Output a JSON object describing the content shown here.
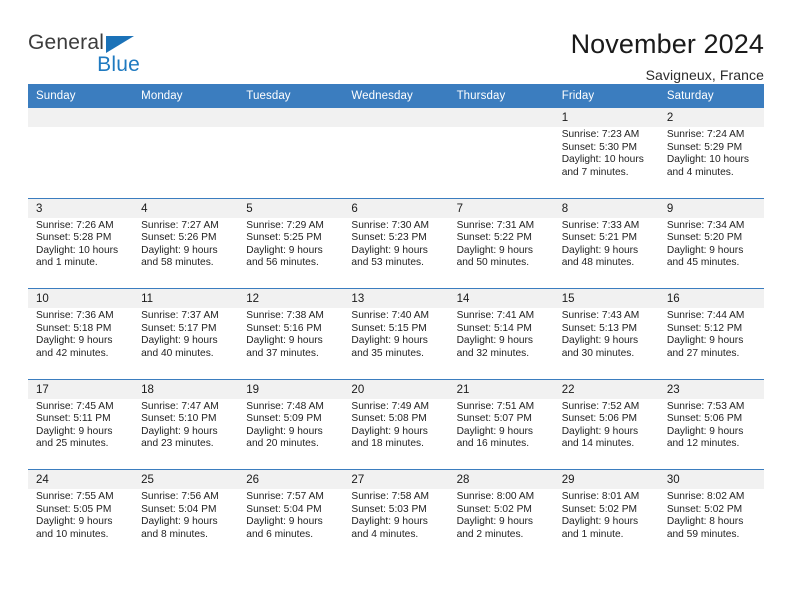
{
  "brand": {
    "name_top": "General",
    "name_bottom": "Blue",
    "color_top": "#3c3c3c",
    "color_blue": "#1b72b8"
  },
  "header": {
    "title": "November 2024",
    "location": "Savigneux, France"
  },
  "calendar": {
    "accent_color": "#3b7dbf",
    "daynum_bg": "#f1f1f1",
    "weekday_headers": [
      "Sunday",
      "Monday",
      "Tuesday",
      "Wednesday",
      "Thursday",
      "Friday",
      "Saturday"
    ],
    "weeks": [
      [
        {
          "day": "",
          "sunrise": "",
          "sunset": "",
          "daylight1": "",
          "daylight2": ""
        },
        {
          "day": "",
          "sunrise": "",
          "sunset": "",
          "daylight1": "",
          "daylight2": ""
        },
        {
          "day": "",
          "sunrise": "",
          "sunset": "",
          "daylight1": "",
          "daylight2": ""
        },
        {
          "day": "",
          "sunrise": "",
          "sunset": "",
          "daylight1": "",
          "daylight2": ""
        },
        {
          "day": "",
          "sunrise": "",
          "sunset": "",
          "daylight1": "",
          "daylight2": ""
        },
        {
          "day": "1",
          "sunrise": "Sunrise: 7:23 AM",
          "sunset": "Sunset: 5:30 PM",
          "daylight1": "Daylight: 10 hours",
          "daylight2": "and 7 minutes."
        },
        {
          "day": "2",
          "sunrise": "Sunrise: 7:24 AM",
          "sunset": "Sunset: 5:29 PM",
          "daylight1": "Daylight: 10 hours",
          "daylight2": "and 4 minutes."
        }
      ],
      [
        {
          "day": "3",
          "sunrise": "Sunrise: 7:26 AM",
          "sunset": "Sunset: 5:28 PM",
          "daylight1": "Daylight: 10 hours",
          "daylight2": "and 1 minute."
        },
        {
          "day": "4",
          "sunrise": "Sunrise: 7:27 AM",
          "sunset": "Sunset: 5:26 PM",
          "daylight1": "Daylight: 9 hours",
          "daylight2": "and 58 minutes."
        },
        {
          "day": "5",
          "sunrise": "Sunrise: 7:29 AM",
          "sunset": "Sunset: 5:25 PM",
          "daylight1": "Daylight: 9 hours",
          "daylight2": "and 56 minutes."
        },
        {
          "day": "6",
          "sunrise": "Sunrise: 7:30 AM",
          "sunset": "Sunset: 5:23 PM",
          "daylight1": "Daylight: 9 hours",
          "daylight2": "and 53 minutes."
        },
        {
          "day": "7",
          "sunrise": "Sunrise: 7:31 AM",
          "sunset": "Sunset: 5:22 PM",
          "daylight1": "Daylight: 9 hours",
          "daylight2": "and 50 minutes."
        },
        {
          "day": "8",
          "sunrise": "Sunrise: 7:33 AM",
          "sunset": "Sunset: 5:21 PM",
          "daylight1": "Daylight: 9 hours",
          "daylight2": "and 48 minutes."
        },
        {
          "day": "9",
          "sunrise": "Sunrise: 7:34 AM",
          "sunset": "Sunset: 5:20 PM",
          "daylight1": "Daylight: 9 hours",
          "daylight2": "and 45 minutes."
        }
      ],
      [
        {
          "day": "10",
          "sunrise": "Sunrise: 7:36 AM",
          "sunset": "Sunset: 5:18 PM",
          "daylight1": "Daylight: 9 hours",
          "daylight2": "and 42 minutes."
        },
        {
          "day": "11",
          "sunrise": "Sunrise: 7:37 AM",
          "sunset": "Sunset: 5:17 PM",
          "daylight1": "Daylight: 9 hours",
          "daylight2": "and 40 minutes."
        },
        {
          "day": "12",
          "sunrise": "Sunrise: 7:38 AM",
          "sunset": "Sunset: 5:16 PM",
          "daylight1": "Daylight: 9 hours",
          "daylight2": "and 37 minutes."
        },
        {
          "day": "13",
          "sunrise": "Sunrise: 7:40 AM",
          "sunset": "Sunset: 5:15 PM",
          "daylight1": "Daylight: 9 hours",
          "daylight2": "and 35 minutes."
        },
        {
          "day": "14",
          "sunrise": "Sunrise: 7:41 AM",
          "sunset": "Sunset: 5:14 PM",
          "daylight1": "Daylight: 9 hours",
          "daylight2": "and 32 minutes."
        },
        {
          "day": "15",
          "sunrise": "Sunrise: 7:43 AM",
          "sunset": "Sunset: 5:13 PM",
          "daylight1": "Daylight: 9 hours",
          "daylight2": "and 30 minutes."
        },
        {
          "day": "16",
          "sunrise": "Sunrise: 7:44 AM",
          "sunset": "Sunset: 5:12 PM",
          "daylight1": "Daylight: 9 hours",
          "daylight2": "and 27 minutes."
        }
      ],
      [
        {
          "day": "17",
          "sunrise": "Sunrise: 7:45 AM",
          "sunset": "Sunset: 5:11 PM",
          "daylight1": "Daylight: 9 hours",
          "daylight2": "and 25 minutes."
        },
        {
          "day": "18",
          "sunrise": "Sunrise: 7:47 AM",
          "sunset": "Sunset: 5:10 PM",
          "daylight1": "Daylight: 9 hours",
          "daylight2": "and 23 minutes."
        },
        {
          "day": "19",
          "sunrise": "Sunrise: 7:48 AM",
          "sunset": "Sunset: 5:09 PM",
          "daylight1": "Daylight: 9 hours",
          "daylight2": "and 20 minutes."
        },
        {
          "day": "20",
          "sunrise": "Sunrise: 7:49 AM",
          "sunset": "Sunset: 5:08 PM",
          "daylight1": "Daylight: 9 hours",
          "daylight2": "and 18 minutes."
        },
        {
          "day": "21",
          "sunrise": "Sunrise: 7:51 AM",
          "sunset": "Sunset: 5:07 PM",
          "daylight1": "Daylight: 9 hours",
          "daylight2": "and 16 minutes."
        },
        {
          "day": "22",
          "sunrise": "Sunrise: 7:52 AM",
          "sunset": "Sunset: 5:06 PM",
          "daylight1": "Daylight: 9 hours",
          "daylight2": "and 14 minutes."
        },
        {
          "day": "23",
          "sunrise": "Sunrise: 7:53 AM",
          "sunset": "Sunset: 5:06 PM",
          "daylight1": "Daylight: 9 hours",
          "daylight2": "and 12 minutes."
        }
      ],
      [
        {
          "day": "24",
          "sunrise": "Sunrise: 7:55 AM",
          "sunset": "Sunset: 5:05 PM",
          "daylight1": "Daylight: 9 hours",
          "daylight2": "and 10 minutes."
        },
        {
          "day": "25",
          "sunrise": "Sunrise: 7:56 AM",
          "sunset": "Sunset: 5:04 PM",
          "daylight1": "Daylight: 9 hours",
          "daylight2": "and 8 minutes."
        },
        {
          "day": "26",
          "sunrise": "Sunrise: 7:57 AM",
          "sunset": "Sunset: 5:04 PM",
          "daylight1": "Daylight: 9 hours",
          "daylight2": "and 6 minutes."
        },
        {
          "day": "27",
          "sunrise": "Sunrise: 7:58 AM",
          "sunset": "Sunset: 5:03 PM",
          "daylight1": "Daylight: 9 hours",
          "daylight2": "and 4 minutes."
        },
        {
          "day": "28",
          "sunrise": "Sunrise: 8:00 AM",
          "sunset": "Sunset: 5:02 PM",
          "daylight1": "Daylight: 9 hours",
          "daylight2": "and 2 minutes."
        },
        {
          "day": "29",
          "sunrise": "Sunrise: 8:01 AM",
          "sunset": "Sunset: 5:02 PM",
          "daylight1": "Daylight: 9 hours",
          "daylight2": "and 1 minute."
        },
        {
          "day": "30",
          "sunrise": "Sunrise: 8:02 AM",
          "sunset": "Sunset: 5:02 PM",
          "daylight1": "Daylight: 8 hours",
          "daylight2": "and 59 minutes."
        }
      ]
    ]
  }
}
